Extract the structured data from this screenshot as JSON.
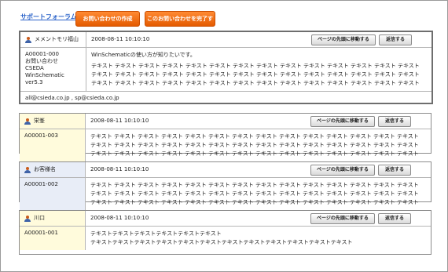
{
  "header": {
    "forum_link": "サポートフォーラム",
    "create_inquiry_button": "お問い合わせの作成",
    "complete_inquiry_button": "このお問い合わせを完了する"
  },
  "buttons": {
    "jump_top": "ページの先頭に移動する",
    "reply": "返信する"
  },
  "threads": [
    {
      "author": "メメントモリ福山",
      "date": "2008-08-11 10:10:10",
      "left_lines": [
        "A00001-000",
        "お問い合わせ",
        "CSEDA WinSchematic",
        "ver5.3"
      ],
      "subject": "WinSchematicの使い方が知りたいです。",
      "body_word": "テキスト",
      "body_word_count": 42,
      "footer": "all@csieda.co.jp , sp@csieda.co.jp"
    },
    {
      "author": "栄峯",
      "date": "2008-08-11 10:10:10",
      "left_lines": [
        "A00001-003"
      ],
      "body_word": "テキスト",
      "body_word_count": 42
    },
    {
      "author": "お客様名",
      "date": "2008-08-11 10:10:10",
      "left_lines": [
        "A00001-002"
      ],
      "body_word": "テキスト",
      "body_word_count": 42
    },
    {
      "author": "川口",
      "date": "2008-08-11 10:10:10",
      "left_lines": [
        "A00001-001"
      ],
      "body_lines": [
        "テキストテキストテキストテキストテキストテキスト",
        "テキストテキストテキストテキストテキストテキストテキストテキストテキストテキストテキストテキスト"
      ]
    }
  ]
}
